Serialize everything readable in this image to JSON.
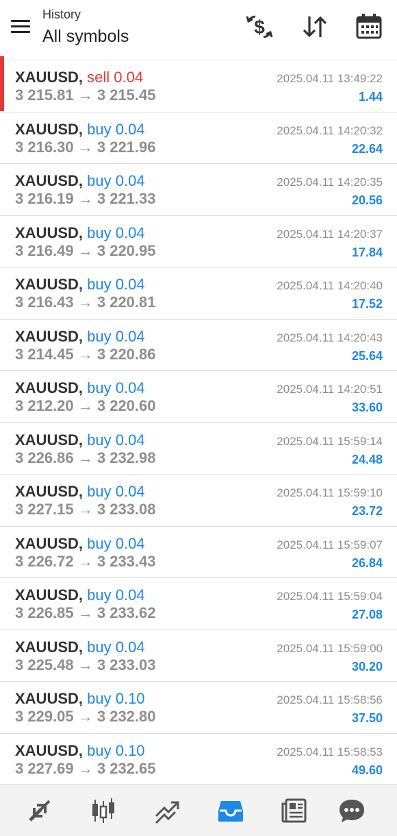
{
  "header": {
    "subtitle": "History",
    "title": "All symbols",
    "icons": [
      "currency-exchange-icon",
      "sort-icon",
      "calendar-icon"
    ]
  },
  "colors": {
    "buy": "#1e88e5",
    "sell": "#e53935",
    "profit": "#1e88e5",
    "muted": "#8e8e8e",
    "active_tab": "#1e88e5"
  },
  "deals": [
    {
      "symbol": "XAUUSD,",
      "side": "sell 0.04",
      "type": "sell",
      "prices": "3 215.81 → 3 215.45",
      "time": "2025.04.11 13:49:22",
      "profit": "1.44"
    },
    {
      "symbol": "XAUUSD,",
      "side": "buy 0.04",
      "type": "buy",
      "prices": "3 216.30 → 3 221.96",
      "time": "2025.04.11 14:20:32",
      "profit": "22.64"
    },
    {
      "symbol": "XAUUSD,",
      "side": "buy 0.04",
      "type": "buy",
      "prices": "3 216.19 → 3 221.33",
      "time": "2025.04.11 14:20:35",
      "profit": "20.56"
    },
    {
      "symbol": "XAUUSD,",
      "side": "buy 0.04",
      "type": "buy",
      "prices": "3 216.49 → 3 220.95",
      "time": "2025.04.11 14:20:37",
      "profit": "17.84"
    },
    {
      "symbol": "XAUUSD,",
      "side": "buy 0.04",
      "type": "buy",
      "prices": "3 216.43 → 3 220.81",
      "time": "2025.04.11 14:20:40",
      "profit": "17.52"
    },
    {
      "symbol": "XAUUSD,",
      "side": "buy 0.04",
      "type": "buy",
      "prices": "3 214.45 → 3 220.86",
      "time": "2025.04.11 14:20:43",
      "profit": "25.64"
    },
    {
      "symbol": "XAUUSD,",
      "side": "buy 0.04",
      "type": "buy",
      "prices": "3 212.20 → 3 220.60",
      "time": "2025.04.11 14:20:51",
      "profit": "33.60"
    },
    {
      "symbol": "XAUUSD,",
      "side": "buy 0.04",
      "type": "buy",
      "prices": "3 226.86 → 3 232.98",
      "time": "2025.04.11 15:59:14",
      "profit": "24.48"
    },
    {
      "symbol": "XAUUSD,",
      "side": "buy 0.04",
      "type": "buy",
      "prices": "3 227.15 → 3 233.08",
      "time": "2025.04.11 15:59:10",
      "profit": "23.72"
    },
    {
      "symbol": "XAUUSD,",
      "side": "buy 0.04",
      "type": "buy",
      "prices": "3 226.72 → 3 233.43",
      "time": "2025.04.11 15:59:07",
      "profit": "26.84"
    },
    {
      "symbol": "XAUUSD,",
      "side": "buy 0.04",
      "type": "buy",
      "prices": "3 226.85 → 3 233.62",
      "time": "2025.04.11 15:59:04",
      "profit": "27.08"
    },
    {
      "symbol": "XAUUSD,",
      "side": "buy 0.04",
      "type": "buy",
      "prices": "3 225.48 → 3 233.03",
      "time": "2025.04.11 15:59:00",
      "profit": "30.20"
    },
    {
      "symbol": "XAUUSD,",
      "side": "buy 0.10",
      "type": "buy",
      "prices": "3 229.05 → 3 232.80",
      "time": "2025.04.11 15:58:56",
      "profit": "37.50"
    },
    {
      "symbol": "XAUUSD,",
      "side": "buy 0.10",
      "type": "buy",
      "prices": "3 227.69 → 3 232.65",
      "time": "2025.04.11 15:58:53",
      "profit": "49.60"
    }
  ],
  "tabs": [
    {
      "name": "quotes-tab",
      "icon": "quotes-icon",
      "active": false
    },
    {
      "name": "chart-tab",
      "icon": "candlestick-icon",
      "active": false
    },
    {
      "name": "trade-tab",
      "icon": "trend-icon",
      "active": false
    },
    {
      "name": "history-tab",
      "icon": "inbox-icon",
      "active": true
    },
    {
      "name": "news-tab",
      "icon": "newspaper-icon",
      "active": false
    },
    {
      "name": "chat-tab",
      "icon": "chat-icon",
      "active": false
    }
  ]
}
